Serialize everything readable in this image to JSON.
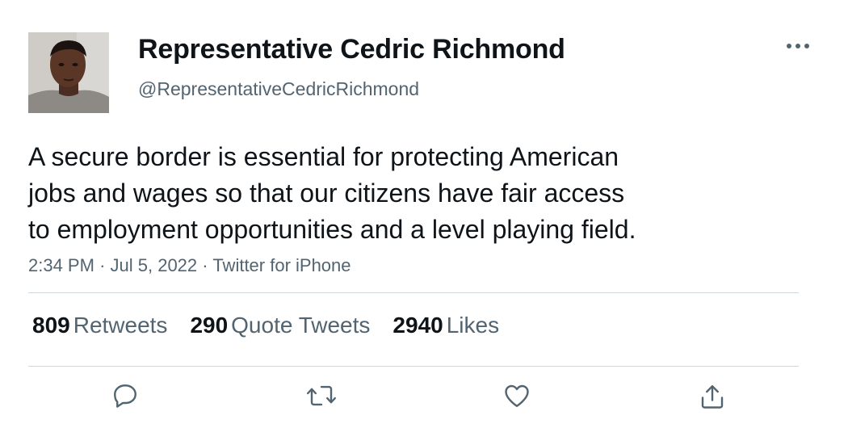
{
  "tweet": {
    "author": {
      "display_name": "Representative Cedric Richmond",
      "handle": "@RepresentativeCedricRichmond"
    },
    "text_lines": [
      "A secure border is essential for protecting American",
      "jobs and wages so that our citizens have fair access",
      "to employment opportunities and a level playing field."
    ],
    "time": "2:34 PM",
    "separator": "·",
    "date": "Jul 5, 2022",
    "source": "Twitter for iPhone",
    "stats": {
      "retweets": {
        "count": "809",
        "label": "Retweets"
      },
      "quote_tweets": {
        "count": "290",
        "label": "Quote Tweets"
      },
      "likes": {
        "count": "2940",
        "label": "Likes"
      }
    }
  },
  "icons": {
    "more": "more-horizontal-icon",
    "reply": "reply-icon",
    "retweet": "retweet-icon",
    "like": "heart-icon",
    "share": "share-icon"
  },
  "colors": {
    "text_primary": "#0f1419",
    "text_secondary": "#536471",
    "divider": "#cfd9de"
  }
}
